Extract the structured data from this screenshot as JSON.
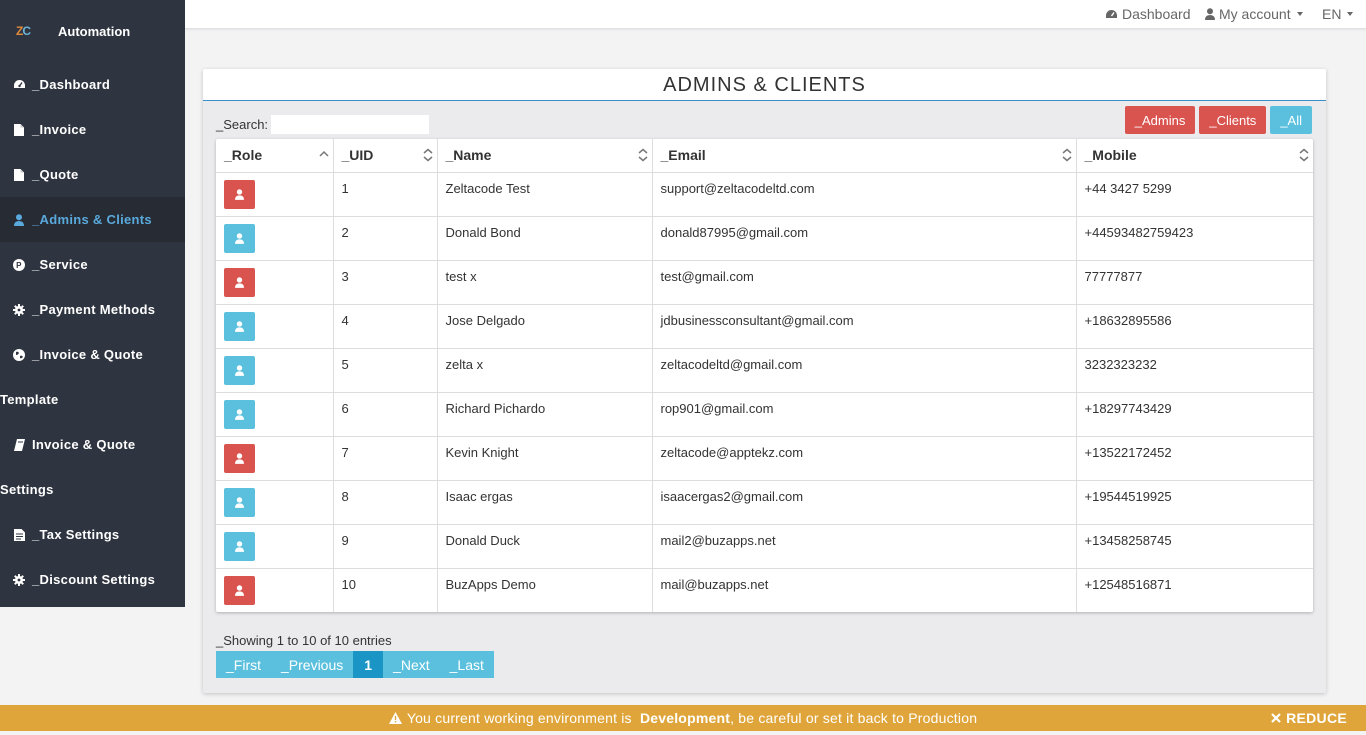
{
  "brand": {
    "logo_left": "Z",
    "logo_right": "C",
    "name": "Automation"
  },
  "sidebar": {
    "items": [
      {
        "label": "_Dashboard",
        "icon": "dashboard-icon"
      },
      {
        "label": "_Invoice",
        "icon": "file-icon"
      },
      {
        "label": "_Quote",
        "icon": "file-icon"
      },
      {
        "label": "_Admins & Clients",
        "icon": "user-icon",
        "active": true
      },
      {
        "label": "_Service",
        "icon": "product-icon"
      },
      {
        "label": "_Payment Methods",
        "icon": "gear-icon"
      }
    ],
    "invoice_quote": "_Invoice & Quote",
    "template_heading": "Template",
    "invoice_quote_template": "Invoice & Quote",
    "settings_heading": "Settings",
    "tax_settings": "_Tax Settings",
    "discount_settings": "_Discount Settings"
  },
  "topbar": {
    "dashboard": "Dashboard",
    "account": "My account",
    "lang": "EN"
  },
  "card": {
    "title": "ADMINS & CLIENTS"
  },
  "search": {
    "label": "_Search:",
    "value": ""
  },
  "filters": {
    "admins": "_Admins",
    "clients": "_Clients",
    "all": "_All"
  },
  "table": {
    "columns": [
      "_Role",
      "_UID",
      "_Name",
      "_Email",
      "_Mobile"
    ],
    "rows": [
      {
        "role": "admin",
        "uid": "1",
        "name": "Zeltacode Test",
        "email": "support@zeltacodeltd.com",
        "mobile": "+44 3427 5299"
      },
      {
        "role": "client",
        "uid": "2",
        "name": "Donald Bond",
        "email": "donald87995@gmail.com",
        "mobile": "+44593482759423"
      },
      {
        "role": "admin",
        "uid": "3",
        "name": "test x",
        "email": "test@gmail.com",
        "mobile": "77777877"
      },
      {
        "role": "client",
        "uid": "4",
        "name": "Jose Delgado",
        "email": "jdbusinessconsultant@gmail.com",
        "mobile": "+18632895586"
      },
      {
        "role": "client",
        "uid": "5",
        "name": "zelta x",
        "email": "zeltacodeltd@gmail.com",
        "mobile": "3232323232"
      },
      {
        "role": "client",
        "uid": "6",
        "name": "Richard Pichardo",
        "email": "rop901@gmail.com",
        "mobile": "+18297743429"
      },
      {
        "role": "admin",
        "uid": "7",
        "name": "Kevin Knight",
        "email": "zeltacode@apptekz.com",
        "mobile": "+13522172452"
      },
      {
        "role": "client",
        "uid": "8",
        "name": "Isaac ergas",
        "email": "isaacergas2@gmail.com",
        "mobile": "+19544519925"
      },
      {
        "role": "client",
        "uid": "9",
        "name": "Donald Duck",
        "email": "mail2@buzapps.net",
        "mobile": "+13458258745"
      },
      {
        "role": "admin",
        "uid": "10",
        "name": "BuzApps Demo",
        "email": "mail@buzapps.net",
        "mobile": "+12548516871"
      }
    ]
  },
  "pagination": {
    "info": "_Showing 1 to 10 of 10 entries",
    "first": "_First",
    "previous": "_Previous",
    "current": "1",
    "next": "_Next",
    "last": "_Last"
  },
  "env_bar": {
    "prefix": "You current working environment is",
    "env": "Development",
    "suffix": ", be careful or set it back to Production",
    "reduce": "REDUCE"
  },
  "colors": {
    "admin": "#d9534f",
    "client": "#5bc0de",
    "sidebar": "#2f3540",
    "banner": "#e0a53a",
    "accent": "#3d8fc7"
  }
}
